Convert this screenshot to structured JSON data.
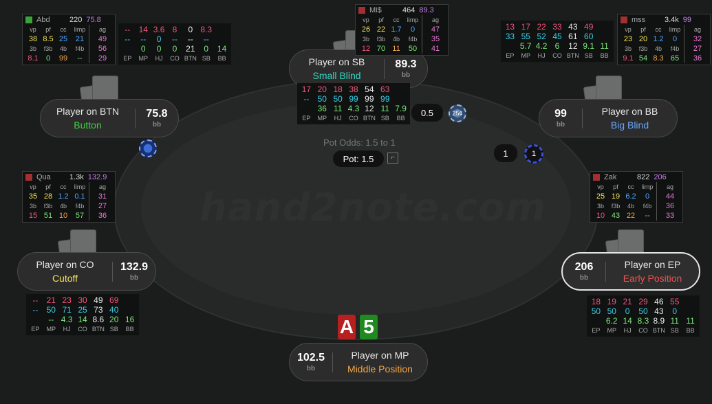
{
  "watermark": "hand2note.com",
  "pot": {
    "odds": "Pot Odds: 1.5 to 1",
    "label": "Pot: 1.5"
  },
  "bets": {
    "sb": "0.5",
    "bb": "1",
    "sb_chip": "25¢",
    "bb_chip": "1"
  },
  "hero_cards": [
    {
      "rank": "A",
      "color": "#b8201f"
    },
    {
      "rank": "5",
      "color": "#1f8a1f"
    }
  ],
  "seats": {
    "btn": {
      "name": "Player on BTN",
      "stack": "75.8",
      "unit": "bb",
      "position": "Button",
      "pos_color": "#3ed23e"
    },
    "sb": {
      "name": "Player on SB",
      "stack": "89.3",
      "unit": "bb",
      "position": "Small Blind",
      "pos_color": "#36d6c2"
    },
    "bb": {
      "name": "Player on BB",
      "stack": "99",
      "unit": "bb",
      "position": "Big Blind",
      "pos_color": "#6aa6ff"
    },
    "co": {
      "name": "Player on CO",
      "stack": "132.9",
      "unit": "bb",
      "position": "Cutoff",
      "pos_color": "#f4e35a"
    },
    "ep": {
      "name": "Player on EP",
      "stack": "206",
      "unit": "bb",
      "position": "Early Position",
      "pos_color": "#f25050"
    },
    "mp": {
      "name": "Player on MP",
      "stack": "102.5",
      "unit": "bb",
      "position": "Middle Position",
      "pos_color": "#f2a447"
    }
  },
  "hud_labels": {
    "vp": "vp",
    "pf": "pf",
    "cc": "cc",
    "limp": "limp",
    "ag": "ag",
    "b3": "3b",
    "f3b": "f3b",
    "b4": "4b",
    "f4b": "f4b"
  },
  "pos_labels": [
    "EP",
    "MP",
    "HJ",
    "CO",
    "BTN",
    "SB",
    "BB"
  ],
  "huds": {
    "abd": {
      "flag": "#3aa33a",
      "name": "Abd",
      "hands": "220",
      "score": "75.8",
      "vp": "38",
      "pf": "8.5",
      "cc": "25",
      "limp": "21",
      "ag1": "49",
      "b3": "8.1",
      "f3b": "0",
      "b4": "99",
      "f4b": "--",
      "ag2": "56",
      "ag3": "29"
    },
    "mi": {
      "flag": "#a33030",
      "name": "Mi$",
      "hands": "464",
      "score": "89.3",
      "vp": "26",
      "pf": "22",
      "cc": "1.7",
      "limp": "0",
      "ag1": "47",
      "b3": "12",
      "f3b": "70",
      "b4": "11",
      "f4b": "50",
      "ag2": "35",
      "ag3": "41"
    },
    "mss": {
      "flag": "#a33030",
      "name": "mss",
      "hands": "3.4k",
      "score": "99",
      "vp": "23",
      "pf": "20",
      "cc": "1.2",
      "limp": "0",
      "ag1": "32",
      "b3": "9.1",
      "f3b": "54",
      "b4": "8.3",
      "f4b": "65",
      "ag2": "27",
      "ag3": "36"
    },
    "qua": {
      "flag": "#a33030",
      "name": "Qua",
      "hands": "1.3k",
      "score": "132.9",
      "vp": "35",
      "pf": "28",
      "cc": "1.2",
      "limp": "0.1",
      "ag1": "31",
      "b3": "15",
      "f3b": "51",
      "b4": "10",
      "f4b": "57",
      "ag2": "27",
      "ag3": "36"
    },
    "zak": {
      "flag": "#a33030",
      "name": "Zak",
      "hands": "822",
      "score": "206",
      "vp": "25",
      "pf": "19",
      "cc": "6.2",
      "limp": "0",
      "ag1": "44",
      "b3": "10",
      "f3b": "43",
      "b4": "22",
      "f4b": "--",
      "ag2": "36",
      "ag3": "33"
    }
  },
  "posstats": {
    "btn": {
      "r1": [
        "--",
        "14",
        "3.6",
        "8",
        "0",
        "8.3",
        ""
      ],
      "r2": [
        "--",
        "--",
        "0",
        "--",
        "--",
        "--",
        ""
      ],
      "r3": [
        "",
        "0",
        "0",
        "0",
        "21",
        "0",
        "14"
      ]
    },
    "sb": {
      "r1": [
        "17",
        "20",
        "18",
        "38",
        "54",
        "63",
        ""
      ],
      "r2": [
        "--",
        "50",
        "50",
        "99",
        "99",
        "99",
        ""
      ],
      "r3": [
        "",
        "36",
        "11",
        "4.3",
        "12",
        "11",
        "7.9"
      ]
    },
    "bb": {
      "r1": [
        "13",
        "17",
        "22",
        "33",
        "43",
        "49",
        ""
      ],
      "r2": [
        "33",
        "55",
        "52",
        "45",
        "61",
        "60",
        ""
      ],
      "r3": [
        "",
        "5.7",
        "4.2",
        "6",
        "12",
        "9.1",
        "11"
      ]
    },
    "co": {
      "r1": [
        "--",
        "21",
        "23",
        "30",
        "49",
        "69",
        ""
      ],
      "r2": [
        "--",
        "50",
        "71",
        "25",
        "73",
        "40",
        ""
      ],
      "r3": [
        "",
        "--",
        "4.3",
        "14",
        "8.6",
        "20",
        "16"
      ]
    },
    "ep": {
      "r1": [
        "18",
        "19",
        "21",
        "29",
        "46",
        "55",
        ""
      ],
      "r2": [
        "50",
        "50",
        "0",
        "50",
        "43",
        "0",
        ""
      ],
      "r3": [
        "",
        "6.2",
        "14",
        "8.3",
        "8.9",
        "11",
        "11"
      ]
    }
  }
}
